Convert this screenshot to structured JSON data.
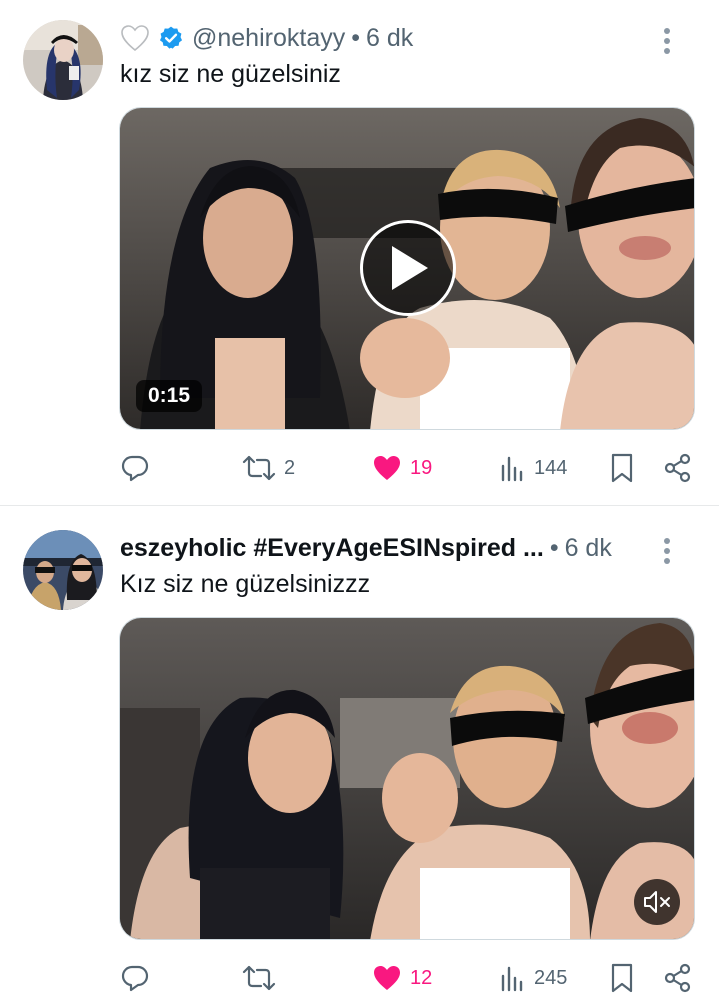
{
  "colors": {
    "like_pink": "#f91880",
    "verified_blue": "#1d9bf0",
    "secondary_text": "#536471"
  },
  "tweets": [
    {
      "handle": "@nehiroktayy",
      "separator": "•",
      "time": "6 dk",
      "text": "kız siz ne güzelsiniz",
      "video_duration": "0:15",
      "stats": {
        "retweets": "2",
        "likes": "19",
        "views": "144"
      }
    },
    {
      "display_name": "eszeyholic #EveryAgeESINspired ...",
      "separator": "•",
      "time": "6 dk",
      "text": "Kız siz ne güzelsinizzz",
      "stats": {
        "likes": "12",
        "views": "245"
      }
    }
  ]
}
